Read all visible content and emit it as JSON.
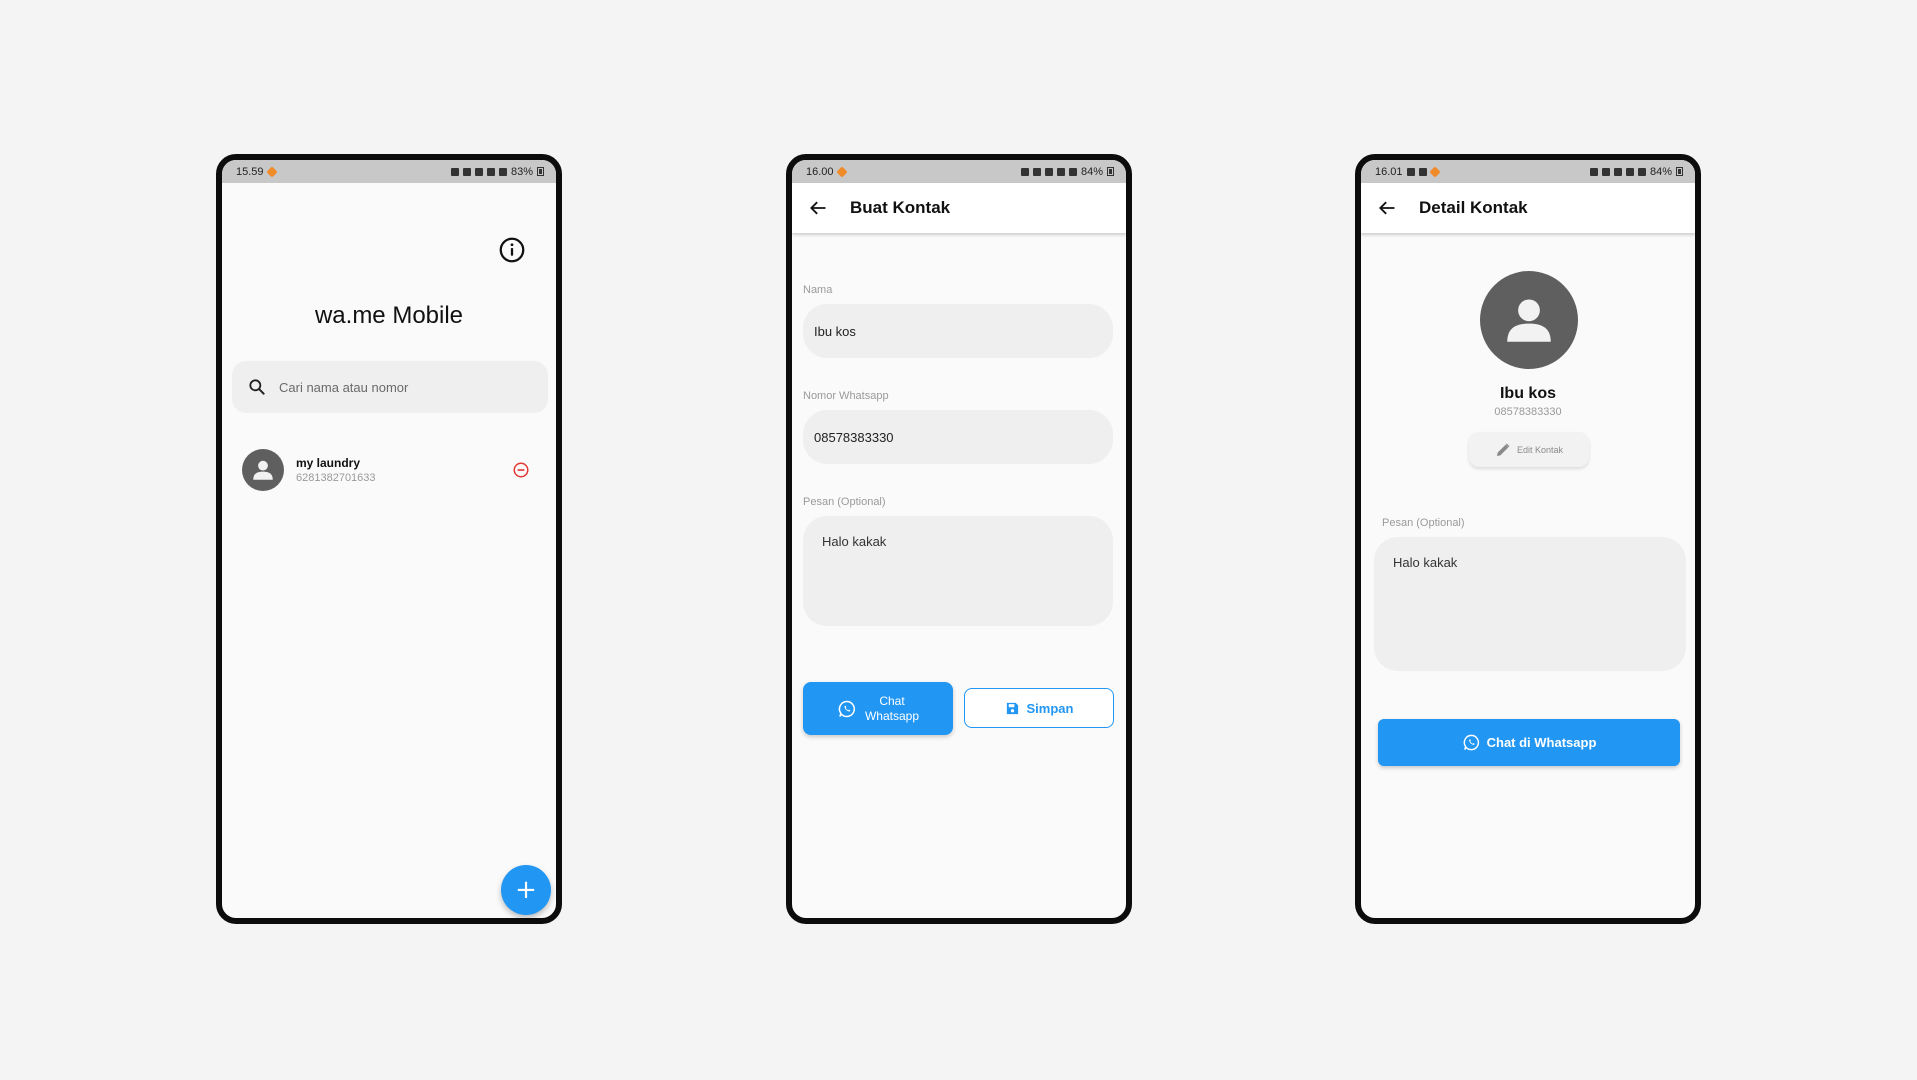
{
  "screens": {
    "home": {
      "status": {
        "time": "15.59",
        "battery": "83%"
      },
      "title": "wa.me Mobile",
      "search": {
        "placeholder": "Cari nama atau nomor"
      },
      "contacts": [
        {
          "name": "my laundry",
          "number": "6281382701633"
        }
      ],
      "fab_label": "+"
    },
    "create": {
      "status": {
        "time": "16.00",
        "battery": "84%"
      },
      "title": "Buat Kontak",
      "name_label": "Nama",
      "name_value": "Ibu kos",
      "number_label": "Nomor Whatsapp",
      "number_value": "08578383330",
      "message_label": "Pesan (Optional)",
      "message_value": "Halo kakak",
      "chat_button_line1": "Chat",
      "chat_button_line2": "Whatsapp",
      "save_button": "Simpan"
    },
    "detail": {
      "status": {
        "time": "16.01",
        "battery": "84%"
      },
      "title": "Detail Kontak",
      "name": "Ibu kos",
      "number": "08578383330",
      "edit_button": "Edit Kontak",
      "message_label": "Pesan (Optional)",
      "message_value": "Halo kakak",
      "chat_button": "Chat di Whatsapp"
    }
  },
  "colors": {
    "accent": "#2196f3",
    "danger": "#e53935",
    "avatar_bg": "#5f5f5f",
    "status_bar": "#c8c8c8"
  },
  "icons": [
    "info-icon",
    "search-icon",
    "person-icon",
    "remove-circle-icon",
    "plus-icon",
    "back-arrow-icon",
    "whatsapp-icon",
    "save-icon",
    "pencil-icon"
  ]
}
